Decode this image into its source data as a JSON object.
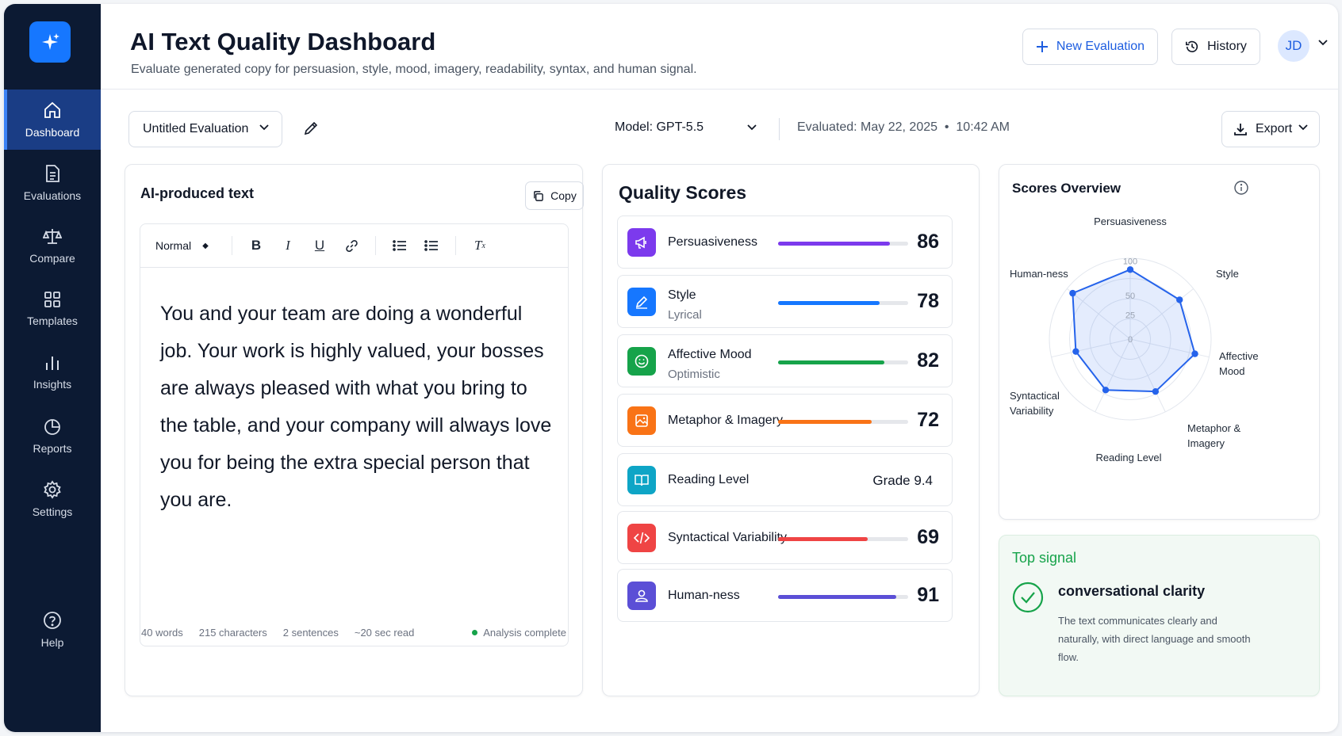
{
  "sidebar": {
    "items": [
      {
        "label": "Dashboard",
        "icon": "home-icon",
        "active": true
      },
      {
        "label": "Evaluations",
        "icon": "document-icon"
      },
      {
        "label": "Compare",
        "icon": "scale-icon"
      },
      {
        "label": "Templates",
        "icon": "grid-icon"
      },
      {
        "label": "Insights",
        "icon": "bar-chart-icon"
      },
      {
        "label": "Reports",
        "icon": "pie-chart-icon"
      },
      {
        "label": "Settings",
        "icon": "gear-icon"
      }
    ],
    "help_label": "Help"
  },
  "header": {
    "title": "AI Text Quality Dashboard",
    "subtitle": "Evaluate generated copy for persuasion, style, mood, imagery, readability, syntax, and human signal.",
    "new_evaluation": "New Evaluation",
    "history": "History",
    "avatar_initials": "JD"
  },
  "toolbar": {
    "document_name": "Untitled Evaluation",
    "model": "Model: GPT-5.5",
    "evaluated": "Evaluated: May 22, 2025  •  10:42 AM",
    "export": "Export"
  },
  "text_panel": {
    "title": "AI-produced text",
    "copy_label": "Copy",
    "style_select": "Normal",
    "body": "You and your team are doing a wonderful job. Your work is highly valued, your bosses are always pleased with what you bring to the table, and your company will always love you for being the extra special person that you are.",
    "stats": {
      "words": "40 words",
      "characters": "215 characters",
      "sentences": "2 sentences",
      "read_time": "~20 sec read",
      "status": "Analysis complete"
    }
  },
  "scores": {
    "title": "Quality Scores",
    "items": [
      {
        "label": "Persuasiveness",
        "sub": "",
        "value": 86,
        "color": "#7c3aed",
        "icon": "megaphone-icon"
      },
      {
        "label": "Style",
        "sub": "Lyrical",
        "value": 78,
        "color": "#1677ff",
        "icon": "pen-icon"
      },
      {
        "label": "Affective Mood",
        "sub": "Optimistic",
        "value": 82,
        "color": "#16a34a",
        "icon": "smile-icon"
      },
      {
        "label": "Metaphor & Imagery",
        "sub": "",
        "value": 72,
        "color": "#f97316",
        "icon": "image-icon"
      },
      {
        "label": "Reading Level",
        "sub": "",
        "grade": "Grade 9.4",
        "color": "#0ea5c6",
        "icon": "book-icon"
      },
      {
        "label": "Syntactical Variability",
        "sub": "",
        "value": 69,
        "color": "#ef4444",
        "icon": "code-icon"
      },
      {
        "label": "Human-ness",
        "sub": "",
        "value": 91,
        "color": "#5b4fd6",
        "icon": "user-icon"
      }
    ]
  },
  "radar": {
    "title": "Scores Overview",
    "ticks": [
      "100",
      "50",
      "25",
      "0"
    ]
  },
  "chart_data": {
    "type": "radar",
    "title": "Scores Overview",
    "axes": [
      "Persuasiveness",
      "Style",
      "Affective Mood",
      "Metaphor & Imagery",
      "Reading Level",
      "Syntactical Variability",
      "Human-ness"
    ],
    "values": [
      86,
      78,
      82,
      72,
      70,
      69,
      91
    ],
    "range": [
      0,
      100
    ],
    "ticks": [
      0,
      25,
      50,
      100
    ]
  },
  "signal": {
    "title": "Top signal",
    "headline": "conversational clarity",
    "description": "The text communicates clearly and naturally, with direct language and smooth flow."
  }
}
